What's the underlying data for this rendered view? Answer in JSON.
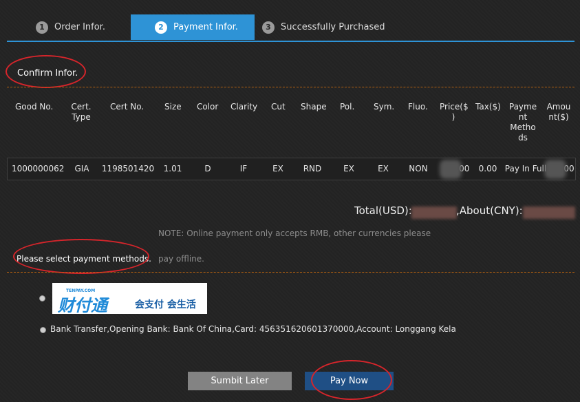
{
  "steps": [
    {
      "num": "1",
      "label": "Order Infor."
    },
    {
      "num": "2",
      "label": "Payment Infor."
    },
    {
      "num": "3",
      "label": "Successfully Purchased"
    }
  ],
  "confirm_title": "Confirm Infor.",
  "table": {
    "headers": {
      "good_no": "Good No.",
      "cert_type": [
        "Cert.",
        "Type"
      ],
      "cert_no": "Cert No.",
      "size": "Size",
      "color": "Color",
      "clarity": "Clarity",
      "cut": "Cut",
      "shape": "Shape",
      "pol": "Pol.",
      "sym": "Sym.",
      "fluo": "Fluo.",
      "price": [
        "Price($",
        ")"
      ],
      "tax": "Tax($)",
      "payment_methods": [
        "Payme",
        "nt",
        "Metho",
        "ds"
      ],
      "amount": [
        "Amou",
        "nt($)"
      ]
    },
    "row": {
      "good_no": "1000000062",
      "cert_type": "GIA",
      "cert_no": "1198501420",
      "size": "1.01",
      "color": "D",
      "clarity": "IF",
      "cut": "EX",
      "shape": "RND",
      "pol": "EX",
      "sym": "EX",
      "fluo": "NON",
      "price": "3.00",
      "tax": "0.00",
      "payment_method": "Pay In Full",
      "amount": "00"
    }
  },
  "totals": {
    "usd_label": "Total(USD):",
    "cny_label": ",About(CNY):"
  },
  "note": {
    "line1": "NOTE: Online payment only accepts RMB, other currencies please",
    "line2": "pay offline."
  },
  "payment_select_label": "Please select payment methods.",
  "payment_options": {
    "tenpay": {
      "small": "TENPAY.COM",
      "brand": "财付通",
      "slogan": "会支付 会生活"
    },
    "bank_transfer": "Bank Transfer,Opening Bank: Bank Of China,Card: 456351620601370000,Account: Longgang Kela"
  },
  "buttons": {
    "submit_later": "Sumbit Later",
    "pay_now": "Pay Now"
  },
  "colors": {
    "accent": "#2e93d6",
    "annotation": "#d6252b",
    "pay_now": "#1f4f85"
  }
}
